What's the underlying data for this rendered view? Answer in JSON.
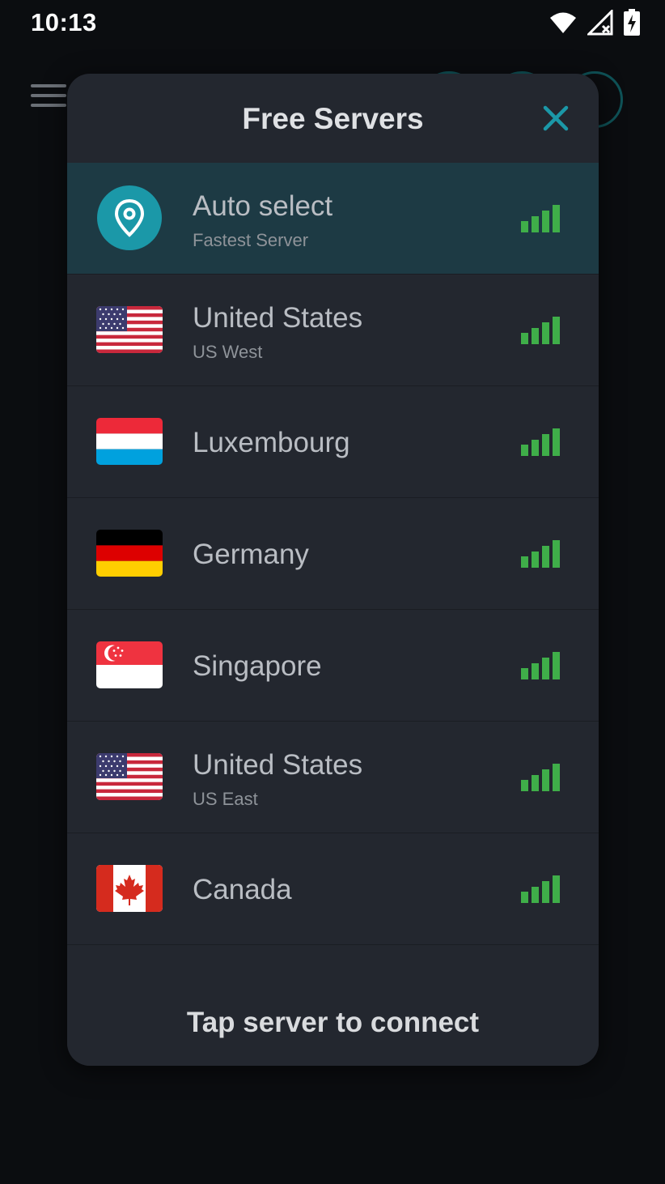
{
  "status_bar": {
    "time": "10:13",
    "icons": [
      "wifi-icon",
      "signal-off-icon",
      "battery-charging-icon"
    ]
  },
  "dialog": {
    "title": "Free Servers",
    "close_icon": "close-icon",
    "footer": "Tap server to connect",
    "colors": {
      "accent": "#1b98a8",
      "signal": "#3fae49",
      "selected_row": "#1d3a44",
      "background": "#23272f"
    }
  },
  "servers": [
    {
      "name": "Auto select",
      "sub": "Fastest Server",
      "icon": "location-pin-icon",
      "selected": true
    },
    {
      "name": "United States",
      "sub": "US West",
      "flag": "us"
    },
    {
      "name": "Luxembourg",
      "sub": "",
      "flag": "lu"
    },
    {
      "name": "Germany",
      "sub": "",
      "flag": "de"
    },
    {
      "name": "Singapore",
      "sub": "",
      "flag": "sg"
    },
    {
      "name": "United States",
      "sub": "US East",
      "flag": "us"
    },
    {
      "name": "Canada",
      "sub": "",
      "flag": "ca"
    }
  ]
}
